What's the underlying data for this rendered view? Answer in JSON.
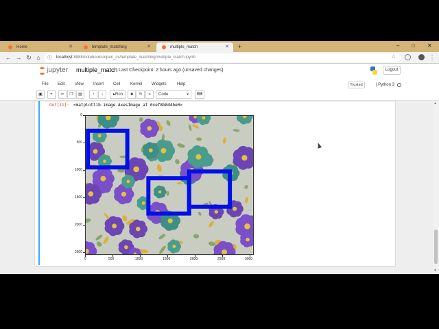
{
  "tabs": [
    {
      "title": "Home",
      "active": false
    },
    {
      "title": "template_matching",
      "active": false
    },
    {
      "title": "multiple_match",
      "active": true
    }
  ],
  "new_tab": "+",
  "window_controls": {
    "minimize": "–",
    "maximize": "□",
    "close": "✕"
  },
  "address": {
    "host": "localhost",
    "rest": ":8888/notebooks/open_cv/template_matching/multiple_match.ipynb"
  },
  "jupyter": {
    "logo_text": "jupyter",
    "notebook_name": "multiple_match",
    "checkpoint": "Last Checkpoint: 2 hours ago",
    "unsaved": "(unsaved changes)",
    "logout": "Logout",
    "trusted": "Trusted",
    "kernel": "| Python 3"
  },
  "menu": [
    "File",
    "Edit",
    "View",
    "Insert",
    "Cell",
    "Kernel",
    "Widgets",
    "Help"
  ],
  "toolbar": {
    "run_label": "Run",
    "cell_type": "Code"
  },
  "output": {
    "prompt": "Out[11]:",
    "text": "<matplotlib.image.AxesImage at 0xef8b8d4be0>"
  },
  "plot": {
    "y_ticks": [
      "0",
      "500",
      "1000",
      "1500",
      "2000",
      "2500"
    ],
    "x_ticks": [
      "0",
      "500",
      "1000",
      "1500",
      "2000",
      "2500",
      "3000"
    ],
    "box_color": "#0010e8"
  },
  "colors": {
    "accent": "#f37626",
    "cell_bar": "#42a5f5",
    "tab_strip": "#d4b477"
  }
}
